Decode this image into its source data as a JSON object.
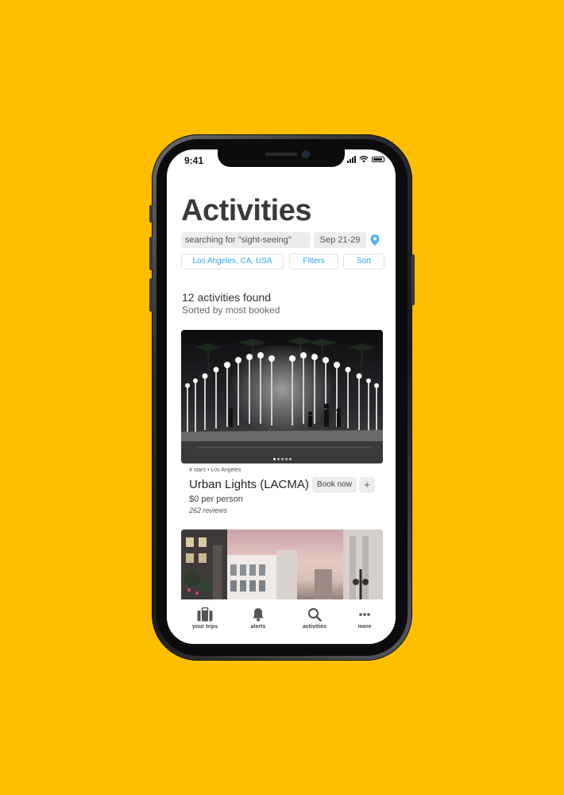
{
  "status_bar": {
    "time": "9:41"
  },
  "page": {
    "title": "Activities"
  },
  "search": {
    "query_label": "searching for \"sight-seeing\"",
    "dates": "Sep 21-29",
    "location_icon": "location-pin-icon"
  },
  "filters": {
    "location": "Los Angeles, CA, USA",
    "filters_label": "Filters",
    "sort_label": "Sort"
  },
  "results": {
    "count_text": "12 activities found",
    "sorted_text": "Sorted by most booked"
  },
  "cards": [
    {
      "meta": "4 stars • Los Angeles",
      "title": "Urban Lights (LACMA)",
      "book_label": "Book now",
      "add_label": "+",
      "price": "$0 per person",
      "reviews": "262 reviews"
    }
  ],
  "tabbar": {
    "items": [
      {
        "label": "your trips",
        "icon": "suitcase-icon"
      },
      {
        "label": "alerts",
        "icon": "bell-icon"
      },
      {
        "label": "activities",
        "icon": "search-icon"
      },
      {
        "label": "more",
        "icon": "more-dots-icon"
      }
    ]
  },
  "colors": {
    "background": "#FFBF00",
    "accent": "#2aa8e6",
    "chip": "#ececec"
  }
}
